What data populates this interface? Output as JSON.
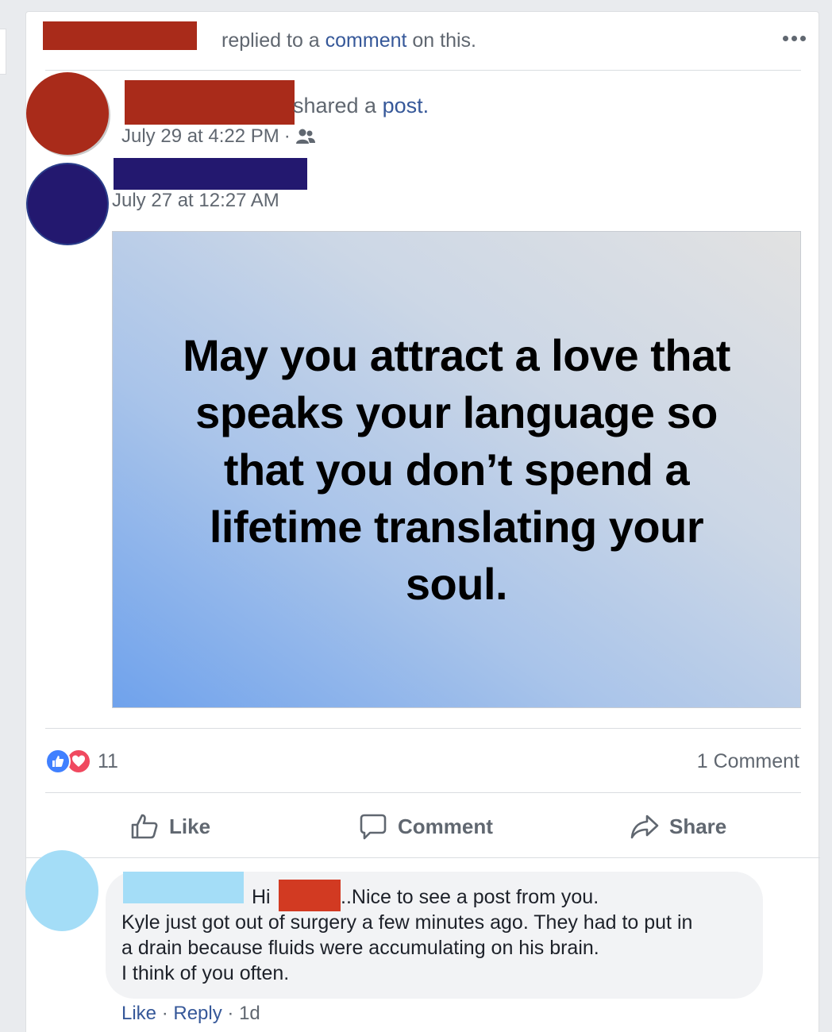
{
  "colors": {
    "redaction_red": "#a92b1a",
    "redaction_orange_red": "#d23a22",
    "redaction_navy": "#23186f",
    "redaction_light_blue": "#a4ddf7",
    "link_blue": "#365899",
    "like_blue": "#4080ff",
    "love_red": "#f0495f"
  },
  "header": {
    "text_before": "replied to a ",
    "link": "comment",
    "text_after": " on this.",
    "more_icon": "ellipsis-icon"
  },
  "shared_post": {
    "text_before": "shared a ",
    "link": "post.",
    "timestamp": "July 29 at 4:22 PM",
    "separator": "·",
    "audience_icon": "friends-icon"
  },
  "original_post": {
    "timestamp": "July 27 at 12:27 AM",
    "quote": "May you attract a love that speaks your language so that you don’t spend a lifetime translating your soul."
  },
  "reactions": {
    "icons": [
      "like-icon",
      "love-icon"
    ],
    "count": "11",
    "comments": "1 Comment"
  },
  "actions": {
    "like": "Like",
    "comment": "Comment",
    "share": "Share"
  },
  "comment": {
    "greeting": "Hi",
    "line1_rest": "..Nice to see a post from you.",
    "line2": "Kyle just got out of surgery a few minutes ago. They had to put in",
    "line3": "a drain because fluids were accumulating on his brain.",
    "line4": "I think of you often.",
    "like": "Like",
    "reply": "Reply",
    "separator": "·",
    "time": "1d"
  }
}
